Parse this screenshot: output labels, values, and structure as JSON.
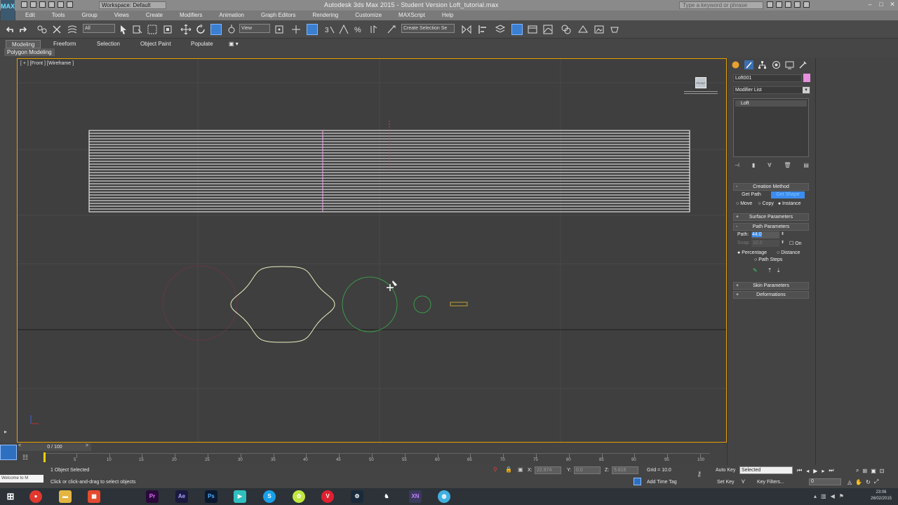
{
  "window": {
    "title": "Autodesk 3ds Max  2015  -  Student Version    Loft_tutorial.max",
    "workspace": "Workspace: Default",
    "search_placeholder": "Type a keyword or phrase",
    "app_logo": "MAX"
  },
  "menu": [
    "Edit",
    "Tools",
    "Group",
    "Views",
    "Create",
    "Modifiers",
    "Animation",
    "Graph Editors",
    "Rendering",
    "Customize",
    "MAXScript",
    "Help"
  ],
  "toolbar": {
    "selection_filter": "All",
    "ref_coord": "View",
    "selection_set": "Create Selection Se"
  },
  "ribbon": {
    "tabs": [
      "Modeling",
      "Freeform",
      "Selection",
      "Object Paint",
      "Populate"
    ],
    "active_tab": "Modeling",
    "sub_label": "Polygon Modeling"
  },
  "viewport": {
    "label": "[ + ] [Front ] [Wireframe ]",
    "viewcube_label": "FRONT"
  },
  "command_panel": {
    "object_name": "Loft001",
    "object_color": "#e890e0",
    "modifier_list_label": "Modifier List",
    "stack_item": "Loft",
    "creation_method": {
      "title": "Creation Method",
      "get_path": "Get Path",
      "get_shape": "Get Shape",
      "move": "Move",
      "copy": "Copy",
      "instance": "Instance"
    },
    "surface_parameters": "Surface Parameters",
    "path_parameters": {
      "title": "Path Parameters",
      "path_label": "Path:",
      "path_value": "44.0",
      "snap_label": "Snap:",
      "snap_value": "10.0",
      "on_label": "On",
      "percentage": "Percentage",
      "distance": "Distance",
      "path_steps": "Path Steps"
    },
    "skin_parameters": "Skin Parameters",
    "deformations": "Deformations"
  },
  "timeline": {
    "frame_display": "0 / 100",
    "ticks": [
      5,
      10,
      15,
      20,
      25,
      30,
      35,
      40,
      45,
      50,
      55,
      60,
      65,
      70,
      75,
      80,
      85,
      90,
      95,
      100
    ]
  },
  "status": {
    "selected_count": "1 Object Selected",
    "prompt": "Click or click-and-drag to select objects",
    "x_label": "X:",
    "x_value": "22.874",
    "y_label": "Y:",
    "y_value": "0.0",
    "z_label": "Z:",
    "z_value": "5.816",
    "grid": "Grid = 10.0",
    "add_time_tag": "Add Time Tag",
    "auto_key": "Auto Key",
    "set_key": "Set Key",
    "key_mode": "Selected",
    "key_filters": "Key Filters...",
    "frame_field": "0",
    "welcome": "Welcome to M"
  },
  "taskbar": {
    "clock_time": "23:06",
    "clock_date": "26/02/2015"
  }
}
